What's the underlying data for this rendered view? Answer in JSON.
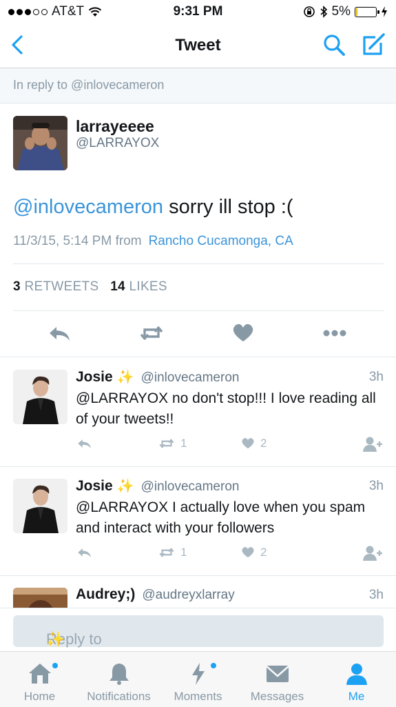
{
  "status_bar": {
    "carrier": "AT&T",
    "time": "9:31 PM",
    "battery": "5%",
    "battery_level": 0.05
  },
  "nav": {
    "title": "Tweet"
  },
  "reply_context": "In reply to @inlovecameron",
  "tweet": {
    "name": "larrayeeee",
    "handle": "@LARRAYOX",
    "mention": "@inlovecameron",
    "text": " sorry ill stop :(",
    "timestamp": "11/3/15, 5:14 PM from",
    "location": "Rancho Cucamonga, CA",
    "retweets_count": "3",
    "retweets_label": "RETWEETS",
    "likes_count": "14",
    "likes_label": "LIKES"
  },
  "replies": [
    {
      "name": "Josie",
      "sparkle": "✨",
      "handle": "@inlovecameron",
      "time": "3h",
      "text": "@LARRAYOX no don't stop!!! I love reading all of your tweets!!",
      "retweets": "1",
      "likes": "2"
    },
    {
      "name": "Josie",
      "sparkle": "✨",
      "handle": "@inlovecameron",
      "time": "3h",
      "text": "@LARRAYOX I actually love when you spam and interact with your followers",
      "retweets": "1",
      "likes": "2"
    },
    {
      "name": "Audrey;)",
      "handle": "@audreyxlarray",
      "time": "3h"
    }
  ],
  "reply_box": {
    "placeholder": "Reply to larrayeeee, Josie",
    "sparkle": "✨"
  },
  "tabs": [
    {
      "label": "Home"
    },
    {
      "label": "Notifications"
    },
    {
      "label": "Moments"
    },
    {
      "label": "Messages"
    },
    {
      "label": "Me"
    }
  ],
  "colors": {
    "accent": "#1da1f2",
    "link": "#3b94d9",
    "muted": "#8899a6"
  }
}
